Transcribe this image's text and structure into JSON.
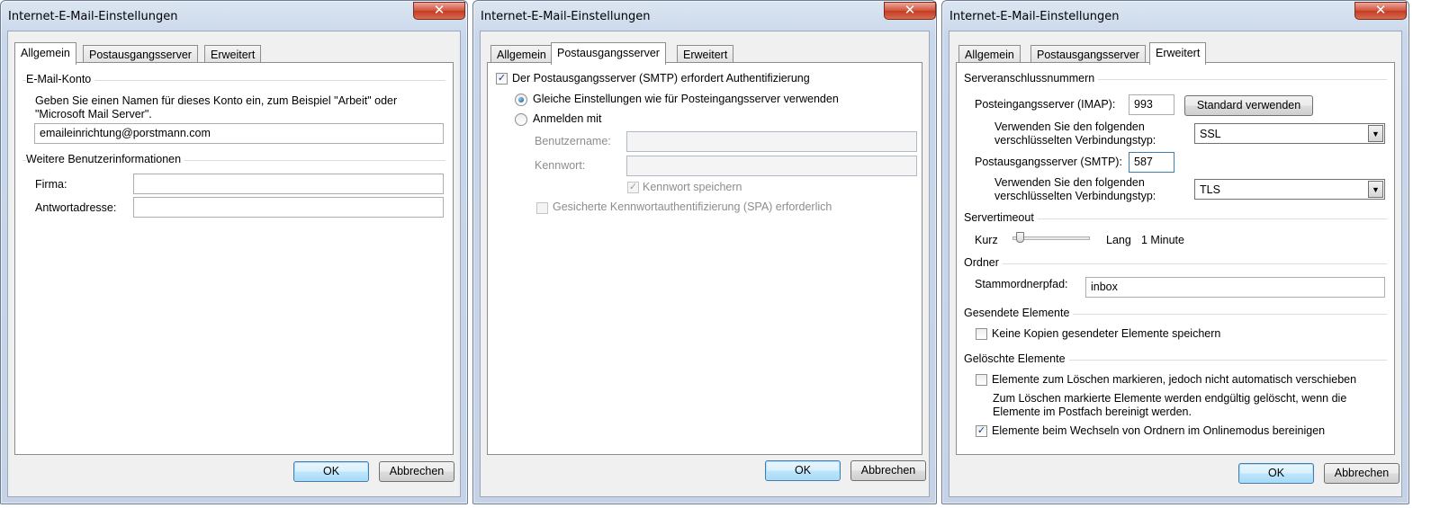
{
  "dialogs": [
    {
      "title": "Internet-E-Mail-Einstellungen",
      "close_glyph": "✕",
      "tabs": [
        "Allgemein",
        "Postausgangsserver",
        "Erweitert"
      ],
      "active_tab": "Allgemein",
      "account_group": {
        "title": "E-Mail-Konto",
        "description": "Geben Sie einen Namen für dieses Konto ein, zum Beispiel \"Arbeit\" oder \"Microsoft Mail Server\".",
        "account_name_value": "emaileinrichtung@porstmann.com"
      },
      "user_group": {
        "title": "Weitere Benutzerinformationen",
        "company_label": "Firma:",
        "company_value": "",
        "reply_label": "Antwortadresse:",
        "reply_value": ""
      },
      "ok_label": "OK",
      "cancel_label": "Abbrechen"
    },
    {
      "title": "Internet-E-Mail-Einstellungen",
      "close_glyph": "✕",
      "tabs": [
        "Allgemein",
        "Postausgangsserver",
        "Erweitert"
      ],
      "active_tab": "Postausgangsserver",
      "smtp_auth": {
        "label": "Der Postausgangsserver (SMTP) erfordert Authentifizierung",
        "checked": true
      },
      "same_settings": {
        "label": "Gleiche Einstellungen wie für Posteingangsserver verwenden",
        "selected": true
      },
      "login_with": {
        "label": "Anmelden mit",
        "selected": false
      },
      "username": {
        "label": "Benutzername:",
        "value": ""
      },
      "password": {
        "label": "Kennwort:",
        "value": ""
      },
      "remember_password": {
        "label": "Kennwort speichern",
        "checked": true
      },
      "spa": {
        "label": "Gesicherte Kennwortauthentifizierung (SPA) erforderlich",
        "checked": false
      },
      "ok_label": "OK",
      "cancel_label": "Abbrechen"
    },
    {
      "title": "Internet-E-Mail-Einstellungen",
      "close_glyph": "✕",
      "tabs": [
        "Allgemein",
        "Postausgangsserver",
        "Erweitert"
      ],
      "active_tab": "Erweitert",
      "ports_group": {
        "title": "Serveranschlussnummern",
        "imap_label": "Posteingangsserver (IMAP):",
        "imap_value": "993",
        "default_button": "Standard verwenden",
        "imap_encryption_label": "Verwenden Sie den folgenden verschlüsselten Verbindungstyp:",
        "imap_encryption_value": "SSL",
        "smtp_label": "Postausgangsserver (SMTP):",
        "smtp_value": "587",
        "smtp_encryption_label": "Verwenden Sie den folgenden verschlüsselten Verbindungstyp:",
        "smtp_encryption_value": "TLS"
      },
      "timeout_group": {
        "title": "Servertimeout",
        "short_label": "Kurz",
        "long_label": "Lang",
        "value_text": "1 Minute",
        "slider_fraction": 0.05
      },
      "folders_group": {
        "title": "Ordner",
        "root_label": "Stammordnerpfad:",
        "root_value": "inbox"
      },
      "sent_group": {
        "title": "Gesendete Elemente",
        "no_copies": {
          "label": "Keine Kopien gesendeter Elemente speichern",
          "checked": false
        }
      },
      "deleted_group": {
        "title": "Gelöschte Elemente",
        "mark_delete": {
          "label": "Elemente zum Löschen markieren, jedoch nicht automatisch verschieben",
          "checked": false
        },
        "mark_note": "Zum Löschen markierte Elemente werden endgültig gelöscht, wenn die Elemente im Postfach bereinigt werden.",
        "purge_online": {
          "label": "Elemente beim Wechseln von Ordnern im Onlinemodus bereinigen",
          "checked": true
        }
      },
      "ok_label": "OK",
      "cancel_label": "Abbrechen"
    }
  ],
  "glyphs": {
    "check": "✓",
    "dropdown_arrow": "▼"
  }
}
